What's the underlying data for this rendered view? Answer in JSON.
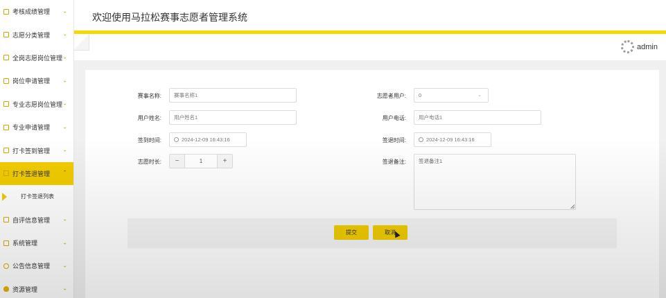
{
  "app": {
    "title": "欢迎使用马拉松赛事志愿者管理系统",
    "user": "admin"
  },
  "sidebar": {
    "items": [
      {
        "label": "考核成绩管理"
      },
      {
        "label": "志愿分类管理"
      },
      {
        "label": "全岗志愿岗位管理"
      },
      {
        "label": "岗位申请管理"
      },
      {
        "label": "专业志愿岗位管理"
      },
      {
        "label": "专业申请管理"
      },
      {
        "label": "打卡签到管理"
      },
      {
        "label": "打卡签退管理"
      },
      {
        "label": "自评信息管理"
      },
      {
        "label": "系统管理"
      },
      {
        "label": "公告信息管理"
      },
      {
        "label": "资源管理"
      }
    ],
    "sub_items": [
      {
        "label": "打卡签退列表"
      }
    ],
    "chevron": "⌄"
  },
  "form": {
    "event_name": {
      "label": "赛事名称:",
      "value": "赛事名称1"
    },
    "volunteer_user": {
      "label": "志愿者用户:",
      "value": "0"
    },
    "user_name": {
      "label": "用户姓名:",
      "value": "用户姓名1"
    },
    "user_phone": {
      "label": "用户电话:",
      "value": "用户电话1"
    },
    "checkin_time": {
      "label": "签到时间:",
      "value": "2024-12-09 16:43:16"
    },
    "checkout_time": {
      "label": "签退时间:",
      "value": "2024-12-09 16:43:16"
    },
    "volunteer_hours": {
      "label": "志愿时长:",
      "value": "1",
      "minus": "−",
      "plus": "+"
    },
    "checkout_remark": {
      "label": "签退备注:",
      "value": "签退备注1"
    }
  },
  "buttons": {
    "submit": "提交",
    "cancel": "取消"
  },
  "colors": {
    "accent": "#f0cc00",
    "header_bar": "#f5d800"
  }
}
